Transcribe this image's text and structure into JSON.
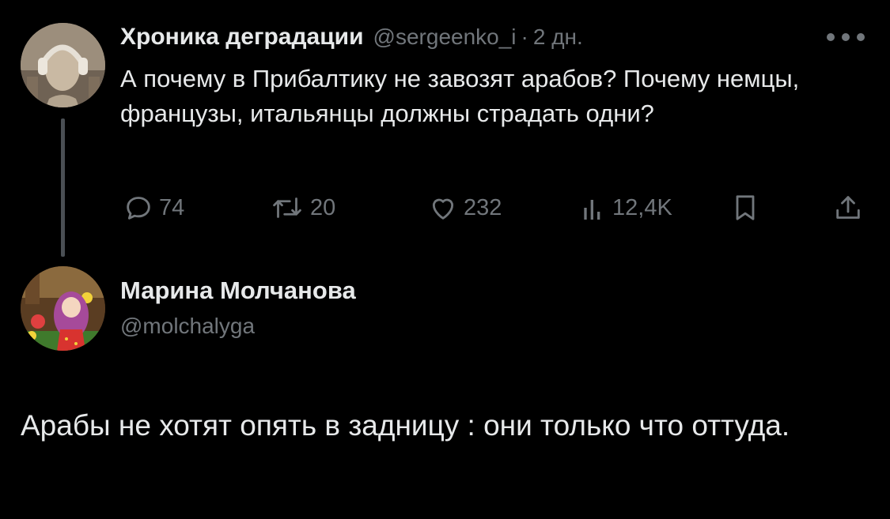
{
  "tweet1": {
    "author_name": "Хроника деградации",
    "handle": "@sergeenko_i",
    "separator": "·",
    "time": "2 дн.",
    "text": "А почему в Прибалтику не завозят арабов? Почему немцы, французы, итальянцы должны страдать одни?",
    "actions": {
      "replies": "74",
      "reposts": "20",
      "likes": "232",
      "views": "12,4K"
    }
  },
  "tweet2": {
    "author_name": "Марина Молчанова",
    "handle": "@molchalyga",
    "text": "Арабы не хотят опять в задницу : они только что оттуда."
  },
  "icons": {
    "more": "more-horizontal-icon",
    "reply": "reply-icon",
    "repost": "repost-icon",
    "like": "heart-icon",
    "views": "views-icon",
    "bookmark": "bookmark-icon",
    "share": "share-icon"
  },
  "colors": {
    "background": "#000000",
    "text": "#e7e9ea",
    "secondary": "#71767b",
    "thread_line": "#4a4f54"
  }
}
